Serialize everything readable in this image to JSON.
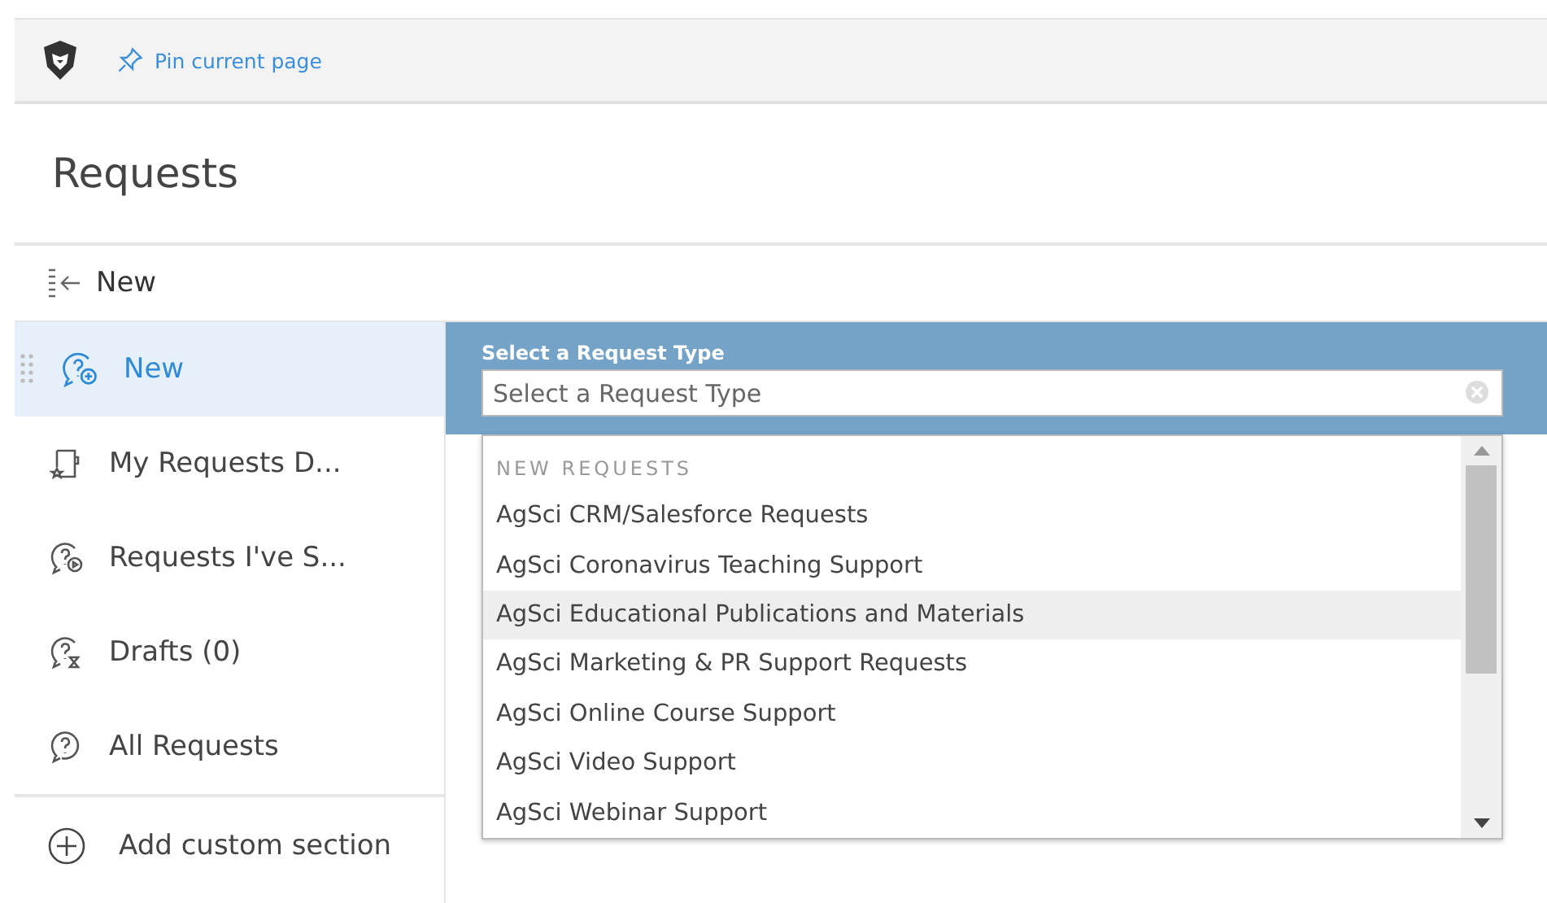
{
  "top_bar": {
    "pin_link": "Pin current page"
  },
  "page_title": "Requests",
  "collapse_bar": {
    "label": "New"
  },
  "sidebar": {
    "items": [
      {
        "label": "New",
        "selected": true,
        "kind": "new"
      },
      {
        "label": "My Requests D...",
        "selected": false,
        "kind": "dashboard"
      },
      {
        "label": "Requests I've S...",
        "selected": false,
        "kind": "submitted"
      },
      {
        "label": "Drafts (0)",
        "selected": false,
        "kind": "drafts"
      },
      {
        "label": "All Requests",
        "selected": false,
        "kind": "all"
      }
    ],
    "add_section": "Add custom section"
  },
  "request_type": {
    "label": "Select a Request Type",
    "placeholder": "Select a Request Type",
    "group_header": "NEW REQUESTS",
    "options": [
      {
        "label": "AgSci CRM/Salesforce Requests",
        "highlighted": false
      },
      {
        "label": "AgSci Coronavirus Teaching Support",
        "highlighted": false
      },
      {
        "label": "AgSci Educational Publications and Materials",
        "highlighted": true
      },
      {
        "label": "AgSci Marketing & PR Support Requests",
        "highlighted": false
      },
      {
        "label": "AgSci Online Course Support",
        "highlighted": false
      },
      {
        "label": "AgSci Video Support",
        "highlighted": false
      },
      {
        "label": "AgSci Webinar Support",
        "highlighted": false
      }
    ]
  }
}
